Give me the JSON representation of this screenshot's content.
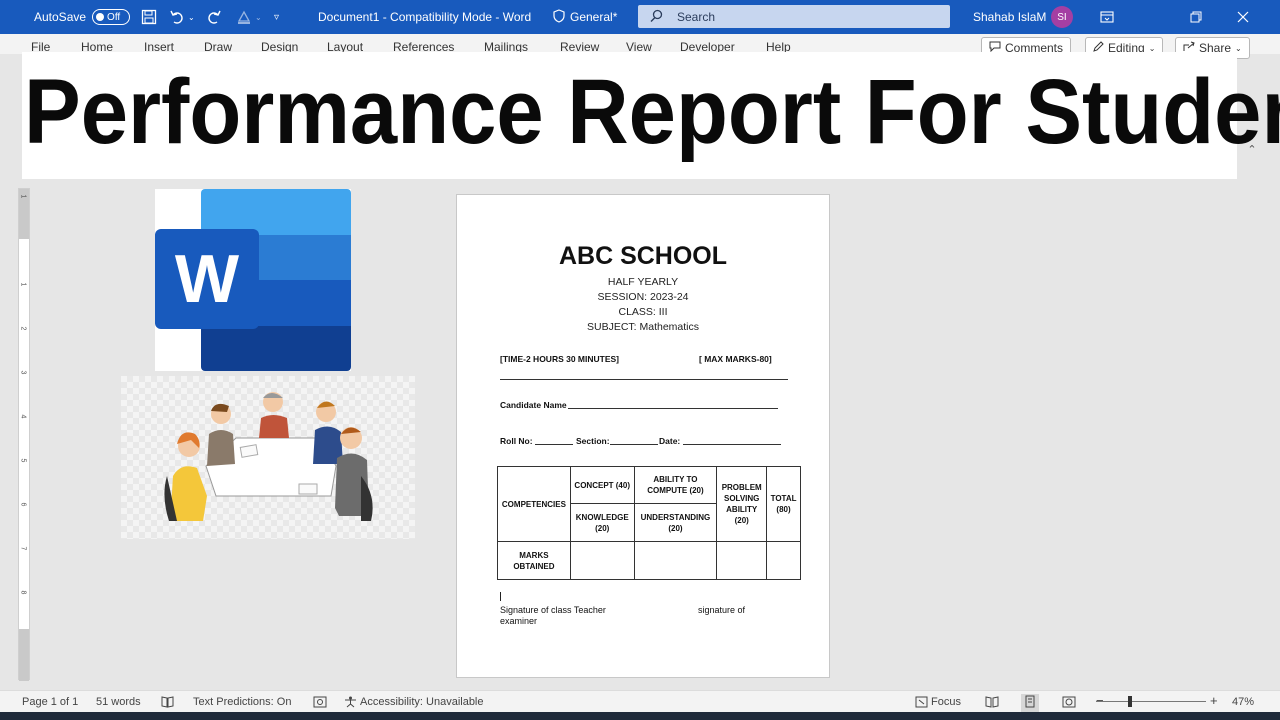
{
  "titlebar": {
    "autosave_label": "AutoSave",
    "autosave_state": "Off",
    "document_title": "Document1  -  Compatibility Mode  -  Word",
    "sensitivity_label": "General*",
    "search_placeholder": "Search",
    "user_name": "Shahab IslaM",
    "user_initials": "SI"
  },
  "ribbon": {
    "tabs": [
      "File",
      "Home",
      "Insert",
      "Draw",
      "Design",
      "Layout",
      "References",
      "Mailings",
      "Review",
      "View",
      "Developer",
      "Help"
    ],
    "comments_label": "Comments",
    "editing_label": "Editing",
    "share_label": "Share"
  },
  "overlay": {
    "headline": "Performance Report For Student"
  },
  "document": {
    "school": "ABC SCHOOL",
    "exam": "HALF YEARLY",
    "session": "SESSION: 2023-24",
    "class": "CLASS: III",
    "subject": "SUBJECT: Mathematics",
    "time": "[TIME-2 HOURS 30 MINUTES]",
    "max_marks": "[ MAX MARKS-80]",
    "candidate_label": "Candidate Name",
    "roll_label": "Roll No:",
    "section_label": "Section:",
    "date_label": "Date:",
    "table": {
      "competencies": "COMPETENCIES",
      "concept": "CONCEPT (40)",
      "ability_to_compute": "ABILITY TO COMPUTE (20)",
      "problem_solving": "PROBLEM SOLVING ABILITY (20)",
      "total": "TOTAL (80)",
      "knowledge": "KNOWLEDGE (20)",
      "understanding": "UNDERSTANDING (20)",
      "marks_obtained": "MARKS OBTAINED"
    },
    "signature_teacher": "Signature of class Teacher",
    "signature_examiner": "signature of",
    "examiner": "examiner"
  },
  "statusbar": {
    "page": "Page 1 of 1",
    "words": "51 words",
    "text_predictions": "Text Predictions: On",
    "accessibility": "Accessibility: Unavailable",
    "focus": "Focus",
    "zoom": "47%"
  },
  "colors": {
    "titlebar": "#185abd",
    "word_blue_dark": "#185abd",
    "word_blue_light": "#41a5ee"
  }
}
